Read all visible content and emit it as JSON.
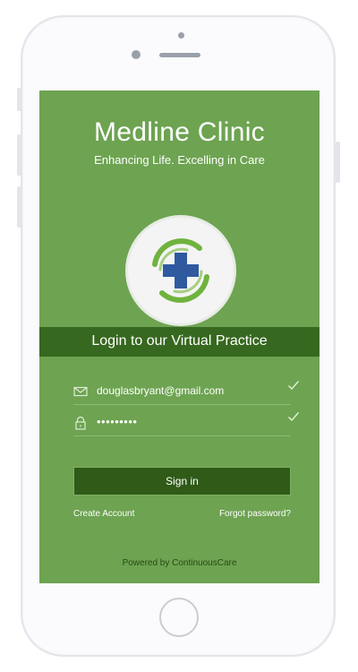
{
  "app": {
    "title": "Medline Clinic",
    "tagline": "Enhancing Life. Excelling in Care",
    "logo_icon": "medical-cross-logo-icon"
  },
  "banner": {
    "text": "Login to our Virtual Practice"
  },
  "login": {
    "email": {
      "value": "douglasbryant@gmail.com",
      "icon": "envelope-icon",
      "valid": true
    },
    "password": {
      "value": "•••••••••",
      "icon": "lock-icon",
      "valid": true
    },
    "signin_label": "Sign in",
    "create_account_label": "Create Account",
    "forgot_password_label": "Forgot password?"
  },
  "footer": {
    "powered_by": "Powered by ContinuousCare"
  },
  "colors": {
    "screen_background": "#6da351",
    "banner_background": "#37681f",
    "button_background": "#2f5a17",
    "logo_cross": "#2f5aa0",
    "logo_arcs": "#6fb33e"
  }
}
